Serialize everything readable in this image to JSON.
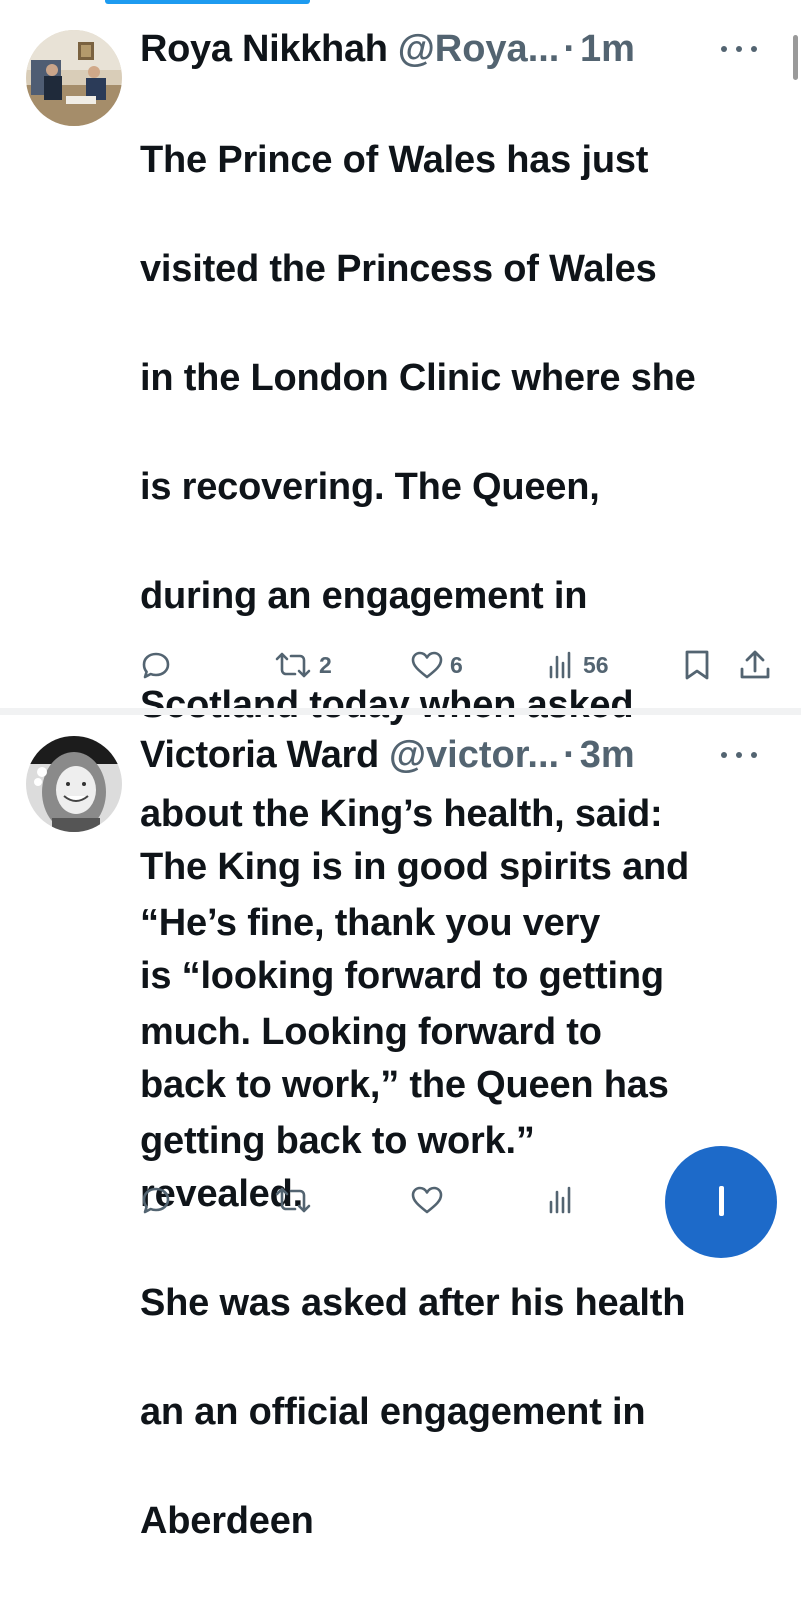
{
  "tweets": [
    {
      "name": "Roya Nikkhah",
      "handle": "@Roya...",
      "separator": "·",
      "time": "1m",
      "text": "The Prince of Wales has just visited the Princess of Wales in the London Clinic where she is recovering. The Queen, during an engagement in Scotland today when asked about the King’s health, said: “He’s fine, thank you very much. Looking forward to getting back to work.”",
      "text_lines": [
        "The Prince of Wales has just",
        "visited the Princess of Wales",
        "in the London Clinic where she",
        "is recovering. The Queen,",
        "during an engagement in",
        "Scotland today when asked",
        "about the King’s health, said:",
        "“He’s fine, thank you very",
        "much. Looking forward to",
        "getting back to work.”"
      ],
      "avatar_icon": "photo-avatar",
      "actions": {
        "reply_icon": "reply-icon",
        "repost_icon": "repost-icon",
        "repost_count": "2",
        "like_icon": "heart-icon",
        "like_count": "6",
        "views_icon": "views-icon",
        "views_count": "56",
        "bookmark_icon": "bookmark-icon",
        "share_icon": "share-icon"
      }
    },
    {
      "name": "Victoria Ward",
      "handle": "@victor...",
      "separator": "·",
      "time": "3m",
      "text": "The King is in good spirits and is “looking forward to getting back to work,” the Queen has revealed.\nShe was asked after his health an an official engagement in Aberdeen",
      "text_lines": [
        "The King is in good spirits and",
        "is “looking forward to getting",
        "back to work,” the Queen has",
        "revealed.",
        "She was asked after his health",
        "an an official engagement in",
        "Aberdeen"
      ],
      "avatar_icon": "photo-avatar",
      "actions": {
        "reply_icon": "reply-icon",
        "repost_icon": "repost-icon",
        "like_icon": "heart-icon",
        "views_icon": "views-icon"
      }
    }
  ],
  "compose_button_icon": "plus-icon",
  "colors": {
    "accent": "#1d9bf0",
    "fab": "#1d6ac9",
    "secondary_text": "#536471",
    "primary_text": "#0f1419"
  }
}
